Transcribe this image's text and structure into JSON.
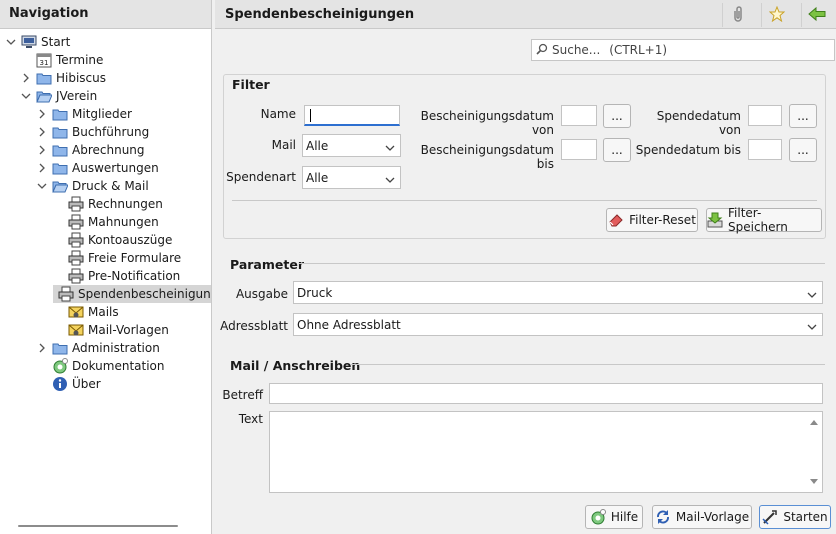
{
  "nav": {
    "title": "Navigation",
    "items": [
      {
        "label": "Start"
      },
      {
        "label": "Termine"
      },
      {
        "label": "Hibiscus"
      },
      {
        "label": "JVerein"
      },
      {
        "label": "Mitglieder"
      },
      {
        "label": "Buchführung"
      },
      {
        "label": "Abrechnung"
      },
      {
        "label": "Auswertungen"
      },
      {
        "label": "Druck & Mail"
      },
      {
        "label": "Rechnungen"
      },
      {
        "label": "Mahnungen"
      },
      {
        "label": "Kontoauszüge"
      },
      {
        "label": "Freie Formulare"
      },
      {
        "label": "Pre-Notification"
      },
      {
        "label": "Spendenbescheinigungen"
      },
      {
        "label": "Mails"
      },
      {
        "label": "Mail-Vorlagen"
      },
      {
        "label": "Administration"
      },
      {
        "label": "Dokumentation"
      },
      {
        "label": "Über"
      }
    ]
  },
  "main": {
    "title": "Spendenbescheinigungen",
    "search_placeholder": "Suche...",
    "search_shortcut": "(CTRL+1)"
  },
  "filter": {
    "title": "Filter",
    "name_label": "Name",
    "name_value": "",
    "mail_label": "Mail",
    "mail_value": "Alle",
    "spendenart_label": "Spendenart",
    "spendenart_value": "Alle",
    "bescheinigung_von_label": "Bescheinigungsdatum von",
    "bescheinigung_bis_label": "Bescheinigungsdatum bis",
    "spende_von_label": "Spendedatum von",
    "spende_bis_label": "Spendedatum bis",
    "date_button_label": "...",
    "reset_label": "Filter-Reset",
    "save_label": "Filter-Speichern"
  },
  "parameter": {
    "title": "Parameter",
    "ausgabe_label": "Ausgabe",
    "ausgabe_value": "Druck",
    "adressblatt_label": "Adressblatt",
    "adressblatt_value": "Ohne Adressblatt"
  },
  "mail": {
    "title": "Mail / Anschreiben",
    "betreff_label": "Betreff",
    "betreff_value": "",
    "text_label": "Text",
    "text_value": ""
  },
  "footer": {
    "hilfe_label": "Hilfe",
    "vorlage_label": "Mail-Vorlage",
    "starten_label": "Starten"
  },
  "colors": {
    "accent": "#2d6fd0",
    "folder": "#5a8fd4",
    "selected": "#d5d5d5"
  }
}
